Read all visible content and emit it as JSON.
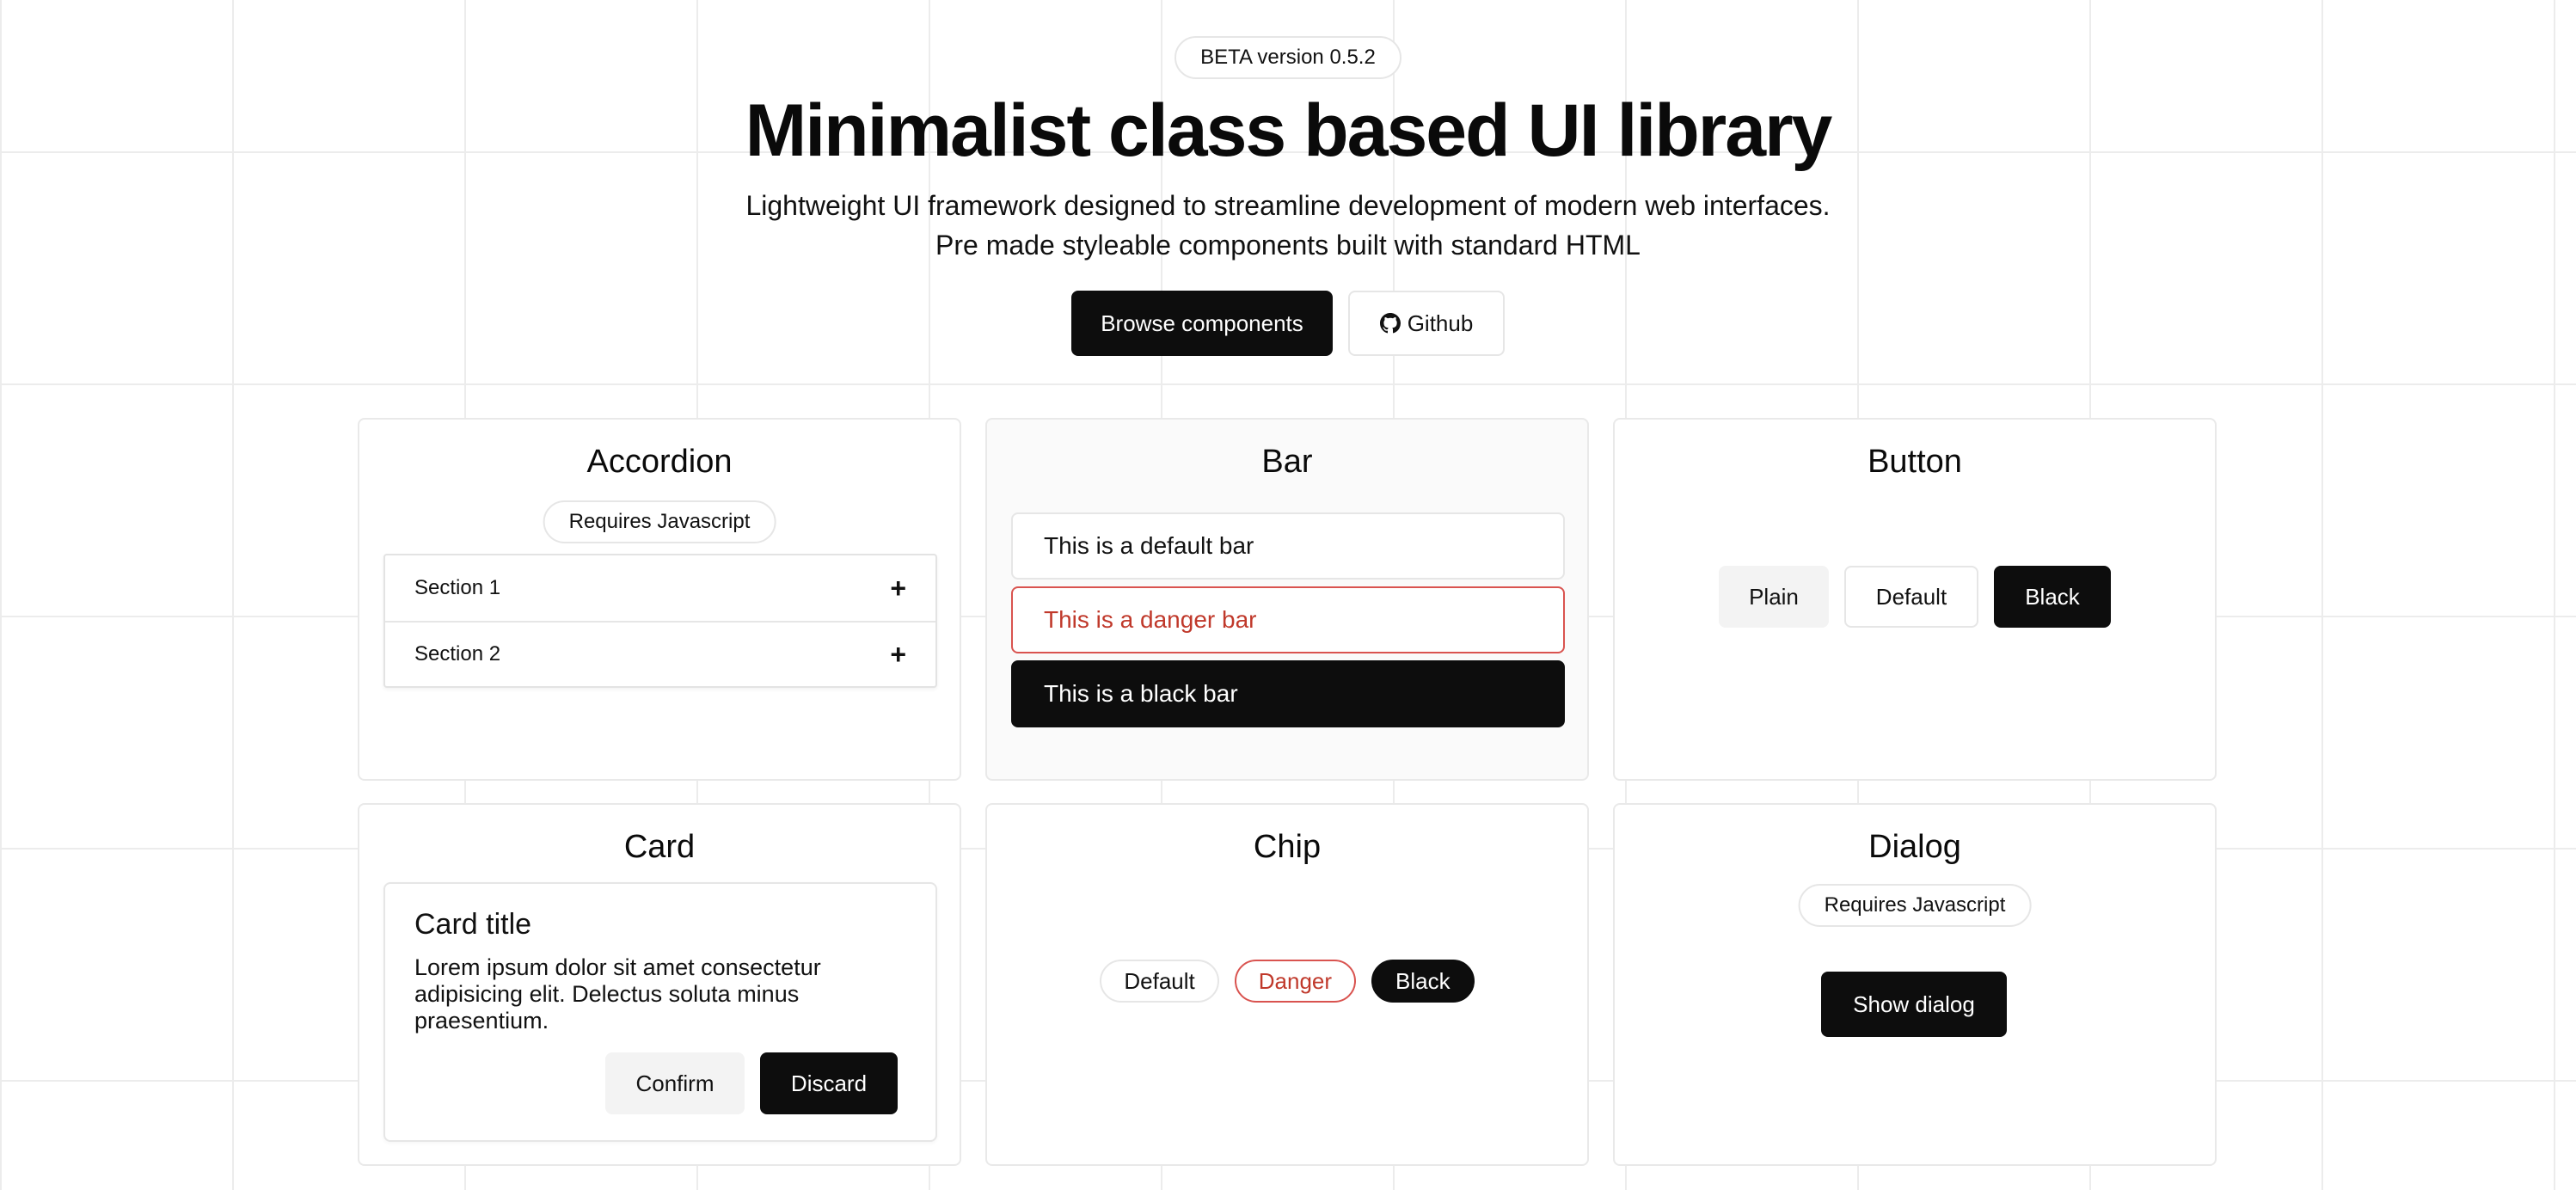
{
  "hero": {
    "badge": "BETA version 0.5.2",
    "title": "Minimalist class based UI library",
    "subtitle_line1": "Lightweight UI framework designed to streamline development of modern web interfaces.",
    "subtitle_line2": "Pre made styleable components built with standard HTML",
    "browse_label": "Browse components",
    "github_label": "Github",
    "github_icon": "github-icon"
  },
  "panels": {
    "accordion": {
      "title": "Accordion",
      "requires": "Requires Javascript",
      "sections": [
        "Section 1",
        "Section 2"
      ],
      "expand_icon": "plus-icon",
      "expand_glyph": "+"
    },
    "bar": {
      "title": "Bar",
      "default": "This is a default bar",
      "danger": "This is a danger bar",
      "black": "This is a black bar"
    },
    "button": {
      "title": "Button",
      "plain": "Plain",
      "default": "Default",
      "black": "Black"
    },
    "card": {
      "title": "Card",
      "card_title": "Card title",
      "card_text": "Lorem ipsum dolor sit amet consectetur adipisicing elit. Delectus soluta minus praesentium.",
      "confirm": "Confirm",
      "discard": "Discard"
    },
    "chip": {
      "title": "Chip",
      "default": "Default",
      "danger": "Danger",
      "black": "Black"
    },
    "dialog": {
      "title": "Dialog",
      "requires": "Requires Javascript",
      "show": "Show dialog"
    }
  },
  "colors": {
    "black": "#0d0d0d",
    "danger": "#c0392b",
    "border": "#e6e6e6",
    "plain": "#f3f3f3"
  }
}
